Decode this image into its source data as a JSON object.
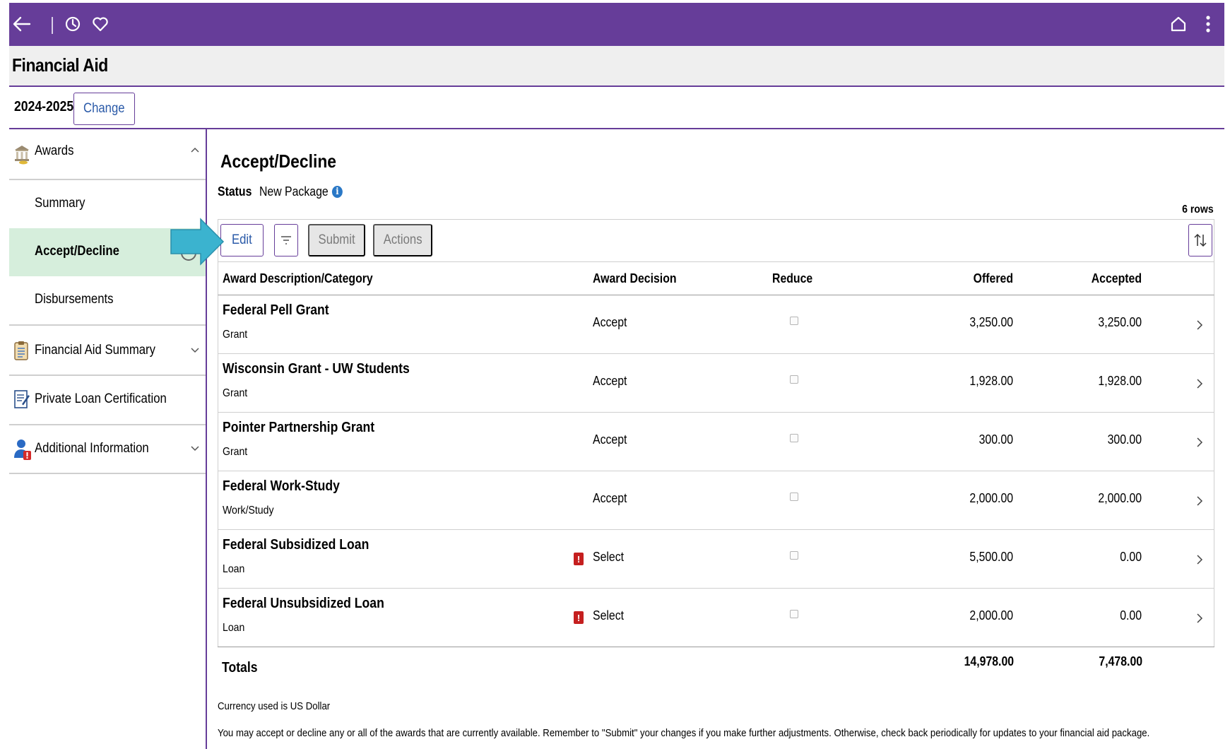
{
  "header": {
    "back_icon": "back-arrow-icon",
    "history_icon": "clock-icon",
    "favorites_icon": "heart-icon",
    "home_icon": "home-icon",
    "menu_icon": "kebab-menu-icon",
    "color": "#663d99"
  },
  "page": {
    "title": "Financial Aid"
  },
  "year": {
    "label": "2024-2025",
    "change_label": "Change"
  },
  "sidebar": {
    "awards": {
      "label": "Awards"
    },
    "items": [
      {
        "label": "Summary"
      },
      {
        "label": "Accept/Decline",
        "selected": true
      },
      {
        "label": "Disbursements"
      }
    ],
    "financial_aid_summary": {
      "label": "Financial Aid Summary"
    },
    "private_loan": {
      "label": "Private Loan Certification"
    },
    "additional_info": {
      "label": "Additional Information"
    }
  },
  "main": {
    "title": "Accept/Decline",
    "status_label": "Status",
    "status_value": "New Package",
    "rows_count": "6 rows",
    "toolbar": {
      "edit": "Edit",
      "submit": "Submit",
      "actions": "Actions"
    },
    "columns": {
      "description": "Award Description/Category",
      "decision": "Award Decision",
      "reduce": "Reduce",
      "offered": "Offered",
      "accepted": "Accepted"
    },
    "rows": [
      {
        "name": "Federal Pell Grant",
        "category": "Grant",
        "decision": "Accept",
        "offered": "3,250.00",
        "accepted": "3,250.00",
        "warning": false
      },
      {
        "name": "Wisconsin Grant - UW Students",
        "category": "Grant",
        "decision": "Accept",
        "offered": "1,928.00",
        "accepted": "1,928.00",
        "warning": false
      },
      {
        "name": "Pointer Partnership Grant",
        "category": "Grant",
        "decision": "Accept",
        "offered": "300.00",
        "accepted": "300.00",
        "warning": false
      },
      {
        "name": "Federal Work-Study",
        "category": "Work/Study",
        "decision": "Accept",
        "offered": "2,000.00",
        "accepted": "2,000.00",
        "warning": false
      },
      {
        "name": "Federal Subsidized Loan",
        "category": "Loan",
        "decision": "Select",
        "offered": "5,500.00",
        "accepted": "0.00",
        "warning": true
      },
      {
        "name": "Federal Unsubsidized Loan",
        "category": "Loan",
        "decision": "Select",
        "offered": "2,000.00",
        "accepted": "0.00",
        "warning": true
      }
    ],
    "totals": {
      "label": "Totals",
      "offered": "14,978.00",
      "accepted": "7,478.00"
    },
    "currency_note": "Currency used is US Dollar",
    "footer_note": "You may accept or decline any or all of the awards that are currently available. Remember to \"Submit\" your changes if you make further adjustments. Otherwise, check back periodically for updates to your financial aid package."
  },
  "annotation": {
    "arrow_color": "#3bb3cf"
  }
}
